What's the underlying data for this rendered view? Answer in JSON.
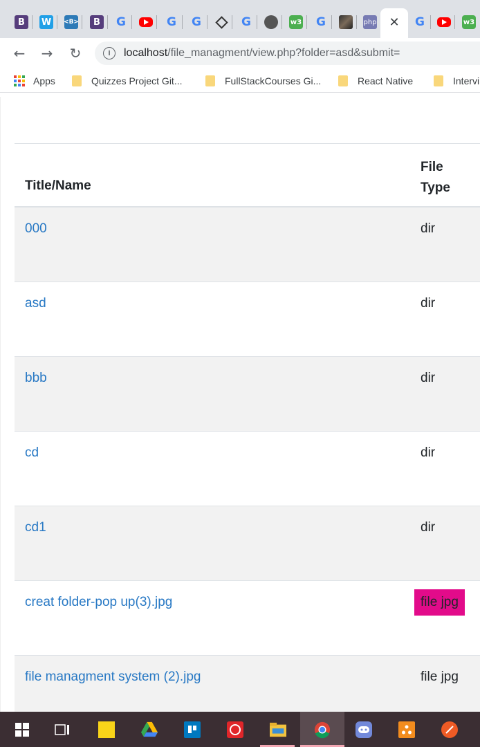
{
  "browser": {
    "tabs": [
      {
        "icon": "bootstrap-icon",
        "glyph": "B"
      },
      {
        "icon": "w-logo-icon",
        "glyph": "W"
      },
      {
        "icon": "bootstrap-blue-icon",
        "glyph": "<B>"
      },
      {
        "icon": "bootstrap-icon",
        "glyph": "B"
      },
      {
        "icon": "google-icon",
        "glyph": "G"
      },
      {
        "icon": "youtube-icon",
        "glyph": ""
      },
      {
        "icon": "google-icon",
        "glyph": "G"
      },
      {
        "icon": "google-icon",
        "glyph": "G"
      },
      {
        "icon": "diamond-icon",
        "glyph": ""
      },
      {
        "icon": "google-icon",
        "glyph": "G"
      },
      {
        "icon": "globe-icon",
        "glyph": ""
      },
      {
        "icon": "w3schools-icon",
        "glyph": "w3"
      },
      {
        "icon": "google-icon",
        "glyph": "G"
      },
      {
        "icon": "photo-icon",
        "glyph": ""
      },
      {
        "icon": "php-icon",
        "glyph": "php"
      },
      {
        "icon": "close-icon",
        "glyph": "✕"
      },
      {
        "icon": "google-icon",
        "glyph": "G"
      },
      {
        "icon": "youtube-icon",
        "glyph": ""
      },
      {
        "icon": "w3schools-icon",
        "glyph": "w3"
      }
    ],
    "url_host": "localhost",
    "url_rest": "/file_managment/view.php?folder=asd&submit=",
    "bookmarks": [
      {
        "label": "Apps",
        "icon": "apps-icon"
      },
      {
        "label": "Quizzes Project Git...",
        "icon": "folder-icon"
      },
      {
        "label": "FullStackCourses Gi...",
        "icon": "folder-icon"
      },
      {
        "label": "React Native",
        "icon": "folder-icon"
      },
      {
        "label": "Intervi",
        "icon": "folder-icon"
      }
    ]
  },
  "table": {
    "header_name": "Title/Name",
    "header_type": "File Type",
    "rows": [
      {
        "name": "000",
        "type": "dir"
      },
      {
        "name": "asd",
        "type": "dir"
      },
      {
        "name": "bbb",
        "type": "dir"
      },
      {
        "name": "cd",
        "type": "dir"
      },
      {
        "name": "cd1",
        "type": "dir"
      },
      {
        "name": "creat folder-pop up(3).jpg",
        "type": "file jpg",
        "highlight": true
      },
      {
        "name": "file managment system (2).jpg",
        "type": "file jpg"
      }
    ],
    "highlight_color": "#e20b8a",
    "link_color": "#2778c4"
  },
  "taskbar": [
    {
      "icon": "windows-start-icon"
    },
    {
      "icon": "task-view-icon"
    },
    {
      "icon": "sticky-notes-icon"
    },
    {
      "icon": "google-drive-icon"
    },
    {
      "icon": "trello-icon"
    },
    {
      "icon": "whatsapp-icon"
    },
    {
      "icon": "file-explorer-icon"
    },
    {
      "icon": "chrome-icon",
      "active": true
    },
    {
      "icon": "discord-icon"
    },
    {
      "icon": "app-orange-icon"
    },
    {
      "icon": "postman-icon"
    }
  ]
}
